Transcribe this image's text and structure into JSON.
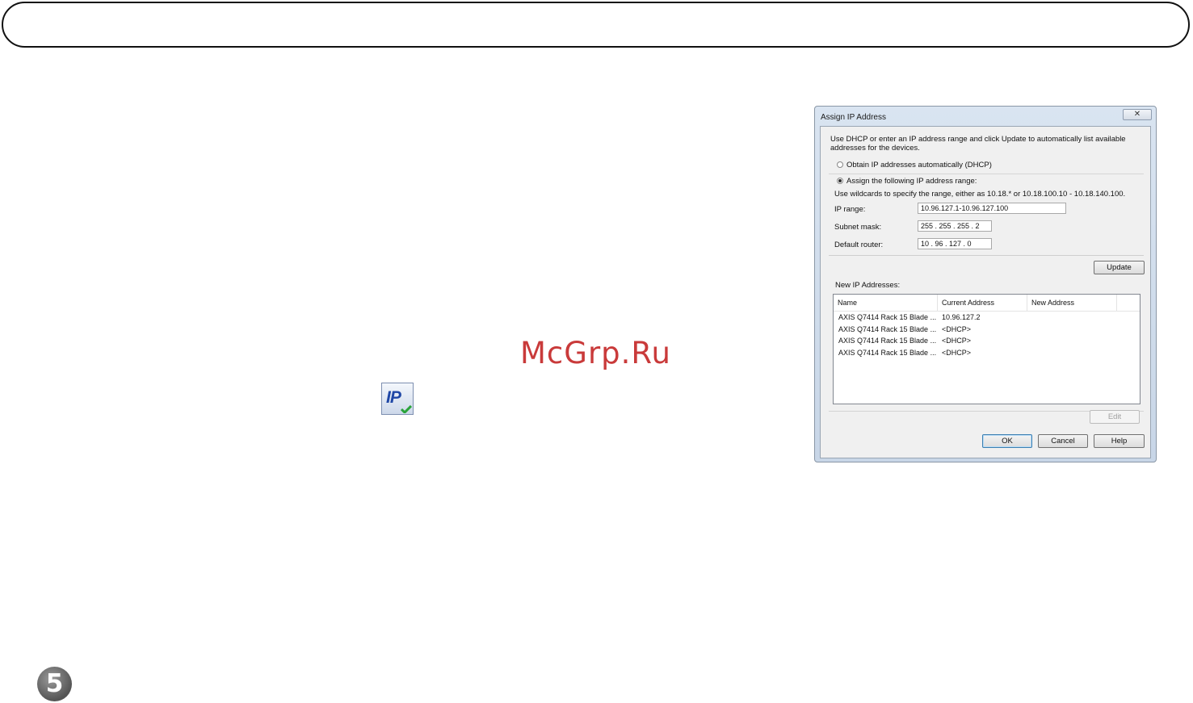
{
  "watermark": "McGrp.Ru",
  "page_number": "5",
  "dialog": {
    "title": "Assign IP Address",
    "close_label": "✕",
    "description": "Use DHCP or enter an IP address range and click Update to automatically list available addresses for the devices.",
    "option_dhcp": "Obtain IP addresses automatically (DHCP)",
    "option_range": "Assign the following IP address range:",
    "selected_option": "range",
    "wildcard_hint": "Use wildcards to specify the range, either as 10.18.* or 10.18.100.10 - 10.18.140.100.",
    "ip_range_label": "IP range:",
    "ip_range_value": "10.96.127.1-10.96.127.100",
    "subnet_label": "Subnet mask:",
    "subnet_value": "255 . 255 . 255 .  2",
    "router_label": "Default router:",
    "router_value": "10  .  96  .  127 .  0",
    "update_label": "Update",
    "list_label": "New IP Addresses:",
    "columns": [
      "Name",
      "Current Address",
      "New Address"
    ],
    "rows": [
      {
        "name": "AXIS Q7414 Rack 15 Blade ...",
        "current": "10.96.127.2",
        "new": ""
      },
      {
        "name": "AXIS Q7414 Rack 15 Blade ...",
        "current": "<DHCP>",
        "new": ""
      },
      {
        "name": "AXIS Q7414 Rack 15 Blade ...",
        "current": "<DHCP>",
        "new": ""
      },
      {
        "name": "AXIS Q7414 Rack 15 Blade ...",
        "current": "<DHCP>",
        "new": ""
      }
    ],
    "edit_label": "Edit",
    "ok_label": "OK",
    "cancel_label": "Cancel",
    "help_label": "Help"
  },
  "ip_icon_text": "IP"
}
